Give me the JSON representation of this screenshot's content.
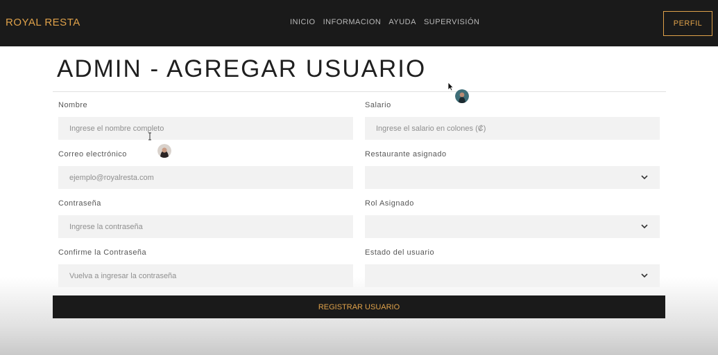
{
  "navbar": {
    "brand": "ROYAL RESTA",
    "links": [
      "INICIO",
      "INFORMACION",
      "AYUDA",
      "SUPERVISIÓN"
    ],
    "profile_button": "PERFIL"
  },
  "page": {
    "title": "ADMIN - AGREGAR USUARIO"
  },
  "form": {
    "nombre": {
      "label": "Nombre",
      "placeholder": "Ingrese el nombre completo"
    },
    "salario": {
      "label": "Salario",
      "placeholder": "Ingrese el salario en colones (₡)"
    },
    "correo": {
      "label": "Correo electrónico",
      "placeholder": "ejemplo@royalresta.com"
    },
    "restaurante": {
      "label": "Restaurante asignado",
      "value": ""
    },
    "contrasena": {
      "label": "Contraseña",
      "placeholder": "Ingrese la contraseña"
    },
    "rol": {
      "label": "Rol Asignado",
      "value": ""
    },
    "confirmar": {
      "label": "Confirme la Contraseña",
      "placeholder": "Vuelva a ingresar la contraseña"
    },
    "estado": {
      "label": "Estado del usuario",
      "value": ""
    },
    "submit_label": "REGISTRAR USUARIO"
  },
  "colors": {
    "navbar_bg": "#1a1a1a",
    "accent": "#e0a24a",
    "input_bg": "#f2f2f2"
  }
}
